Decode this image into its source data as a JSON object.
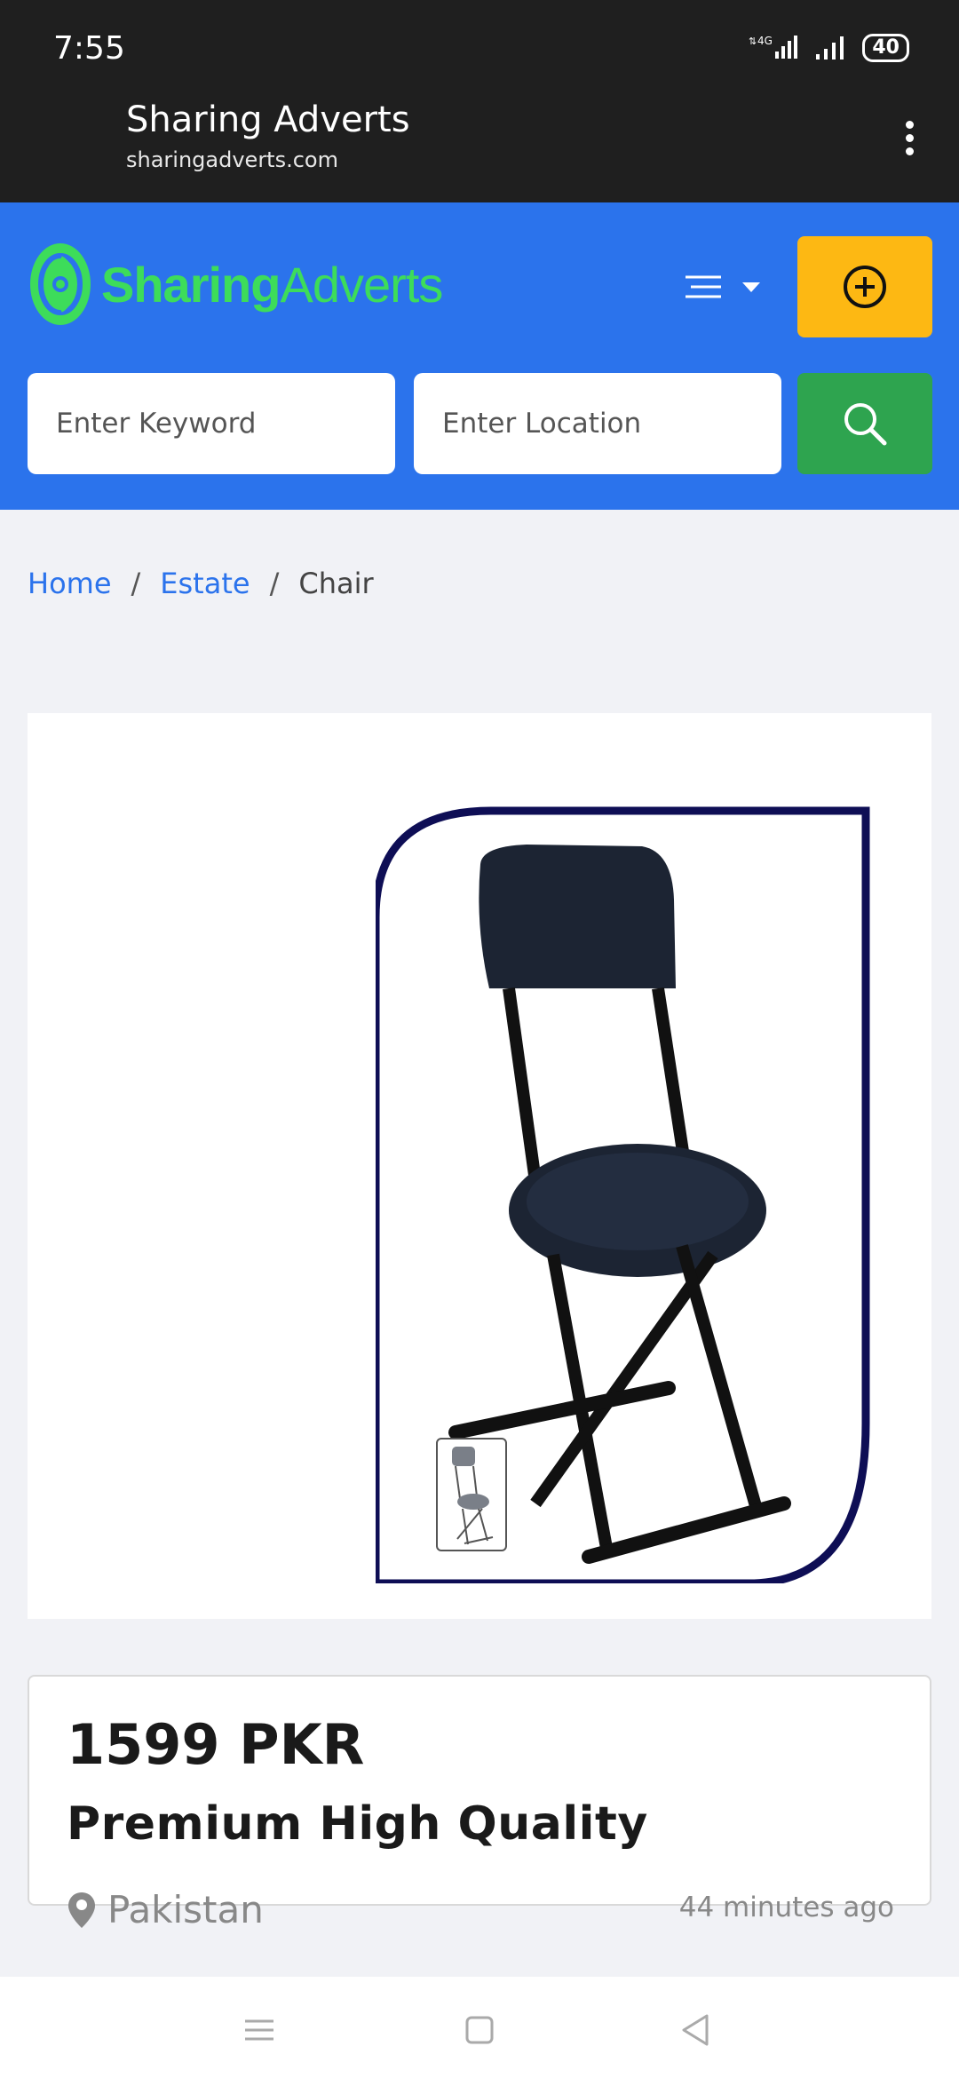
{
  "status_bar": {
    "time": "7:55",
    "network": "4G",
    "battery": "40"
  },
  "browser": {
    "title": "Sharing Adverts",
    "url": "sharingadverts.com"
  },
  "header": {
    "logo_primary": "Sharing",
    "logo_secondary": "Adverts",
    "keyword_placeholder": "Enter Keyword",
    "location_placeholder": "Enter Location",
    "colors": {
      "header_bg": "#2b73ec",
      "post_button": "#fdb813",
      "search_button": "#2ea44f",
      "logo": "#3ddc5a"
    }
  },
  "breadcrumb": {
    "items": [
      {
        "label": "Home"
      },
      {
        "label": "Estate"
      },
      {
        "label": "Chair"
      }
    ],
    "separator": "/"
  },
  "listing": {
    "price": "1599 PKR",
    "title": "Premium High Quality",
    "location": "Pakistan",
    "posted": "44 minutes ago"
  }
}
